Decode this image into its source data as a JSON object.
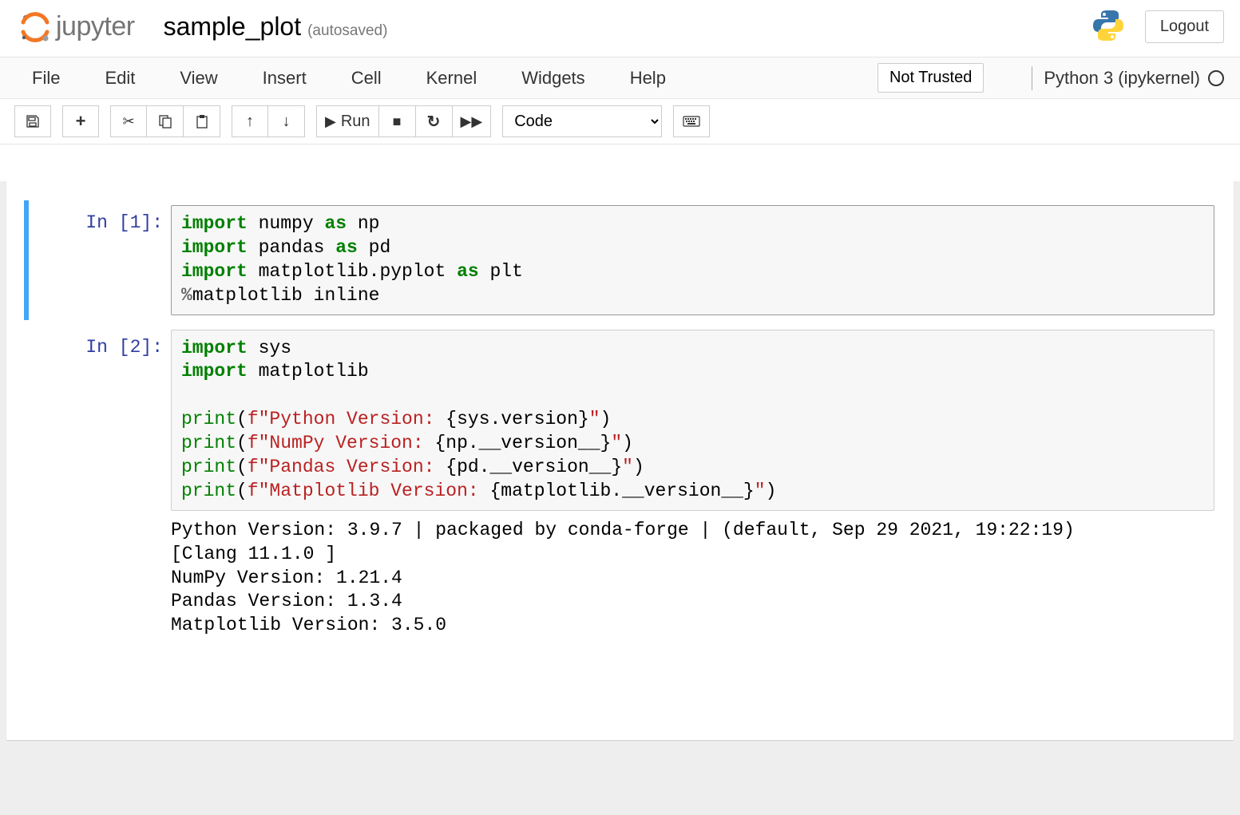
{
  "header": {
    "app_name": "jupyter",
    "notebook_name": "sample_plot",
    "save_status": "(autosaved)",
    "logout": "Logout"
  },
  "menubar": {
    "items": [
      "File",
      "Edit",
      "View",
      "Insert",
      "Cell",
      "Kernel",
      "Widgets",
      "Help"
    ],
    "trust": "Not Trusted",
    "kernel_name": "Python 3 (ipykernel)"
  },
  "toolbar": {
    "run_label": "Run",
    "cell_type": "Code"
  },
  "cells": [
    {
      "prompt": "In [1]:",
      "code_html": "<span class=\"kw\">import</span> numpy <span class=\"kw\">as</span> np\n<span class=\"kw\">import</span> pandas <span class=\"kw\">as</span> pd\n<span class=\"kw\">import</span> matplotlib.pyplot <span class=\"kw\">as</span> plt\n<span class=\"op\">%</span><span class=\"nm\">matplotlib</span> inline",
      "output": null,
      "selected": true
    },
    {
      "prompt": "In [2]:",
      "code_html": "<span class=\"kw\">import</span> sys\n<span class=\"kw\">import</span> matplotlib\n\n<span class=\"fn\">print</span>(<span class=\"str\">f\"Python Version: </span>{sys.version}<span class=\"str\">\"</span>)\n<span class=\"fn\">print</span>(<span class=\"str\">f\"NumPy Version: </span>{np.__version__}<span class=\"str\">\"</span>)\n<span class=\"fn\">print</span>(<span class=\"str\">f\"Pandas Version: </span>{pd.__version__}<span class=\"str\">\"</span>)\n<span class=\"fn\">print</span>(<span class=\"str\">f\"Matplotlib Version: </span>{matplotlib.__version__}<span class=\"str\">\"</span>)",
      "output": "Python Version: 3.9.7 | packaged by conda-forge | (default, Sep 29 2021, 19:22:19) \n[Clang 11.1.0 ]\nNumPy Version: 1.21.4\nPandas Version: 1.3.4\nMatplotlib Version: 3.5.0",
      "selected": false
    }
  ]
}
